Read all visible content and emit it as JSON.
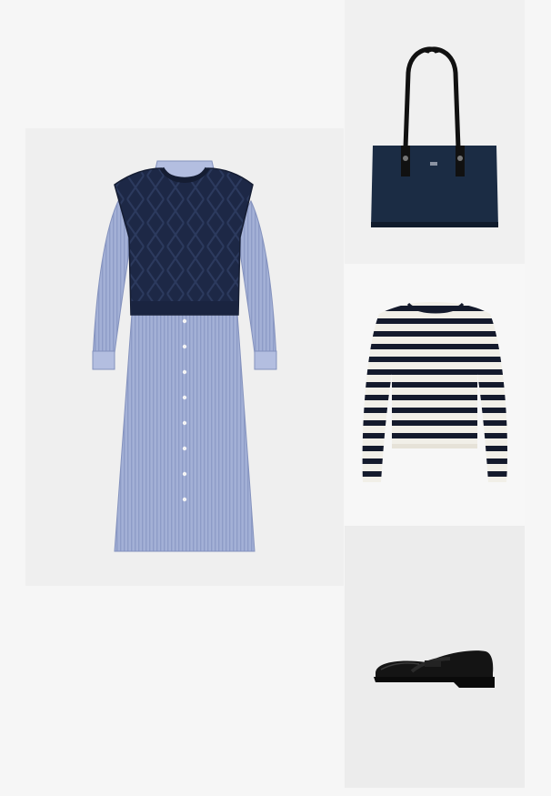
{
  "collage": {
    "items": [
      {
        "id": "dress",
        "icon": "dress-with-knit-vest-icon"
      },
      {
        "id": "bag",
        "icon": "tote-bag-icon"
      },
      {
        "id": "top",
        "icon": "striped-sweater-icon"
      },
      {
        "id": "shoe",
        "icon": "loafer-icon"
      }
    ],
    "colors": {
      "navy": "#1c2a47",
      "dress_blue": "#9aa8cf",
      "stripe": "#141a2c",
      "cream": "#f1efe8",
      "shoe_black": "#141414"
    }
  }
}
